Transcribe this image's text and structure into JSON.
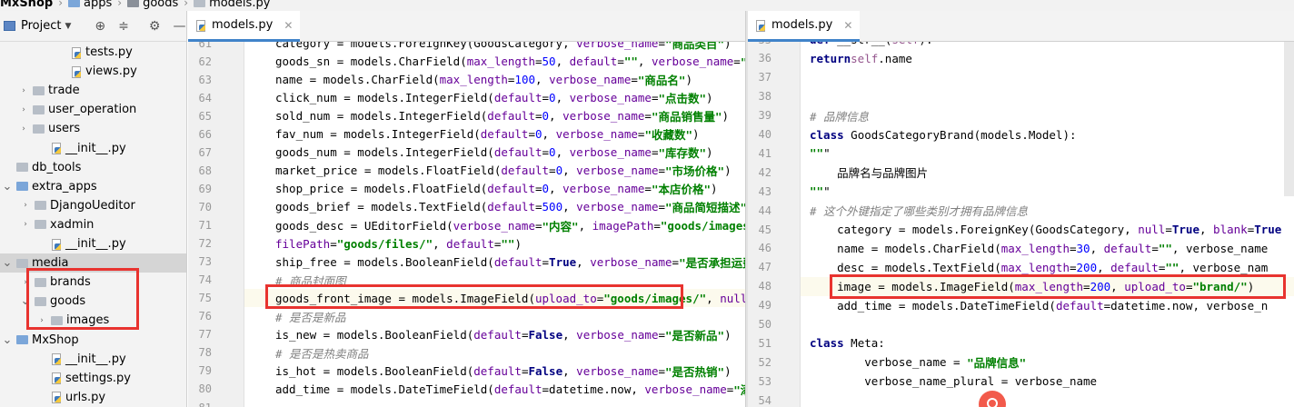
{
  "breadcrumb": {
    "items": [
      "MxShop",
      "apps",
      "goods",
      "models.py"
    ]
  },
  "project_panel": {
    "title": "Project",
    "tree": [
      {
        "label": "tests.py",
        "type": "py",
        "expanded": null
      },
      {
        "label": "views.py",
        "type": "py",
        "expanded": null
      },
      {
        "label": "trade",
        "type": "folder",
        "expanded": false
      },
      {
        "label": "user_operation",
        "type": "folder",
        "expanded": false
      },
      {
        "label": "users",
        "type": "folder",
        "expanded": false
      },
      {
        "label": "__init__.py",
        "type": "py",
        "expanded": null
      },
      {
        "label": "db_tools",
        "type": "folder",
        "expanded": null
      },
      {
        "label": "extra_apps",
        "type": "folder",
        "expanded": true
      },
      {
        "label": "DjangoUeditor",
        "type": "folder",
        "expanded": false
      },
      {
        "label": "xadmin",
        "type": "folder",
        "expanded": false
      },
      {
        "label": "__init__.py",
        "type": "py",
        "expanded": null
      },
      {
        "label": "media",
        "type": "folder",
        "expanded": true
      },
      {
        "label": "brands",
        "type": "folder",
        "expanded": false
      },
      {
        "label": "goods",
        "type": "folder",
        "expanded": true
      },
      {
        "label": "images",
        "type": "folder",
        "expanded": false
      },
      {
        "label": "MxShop",
        "type": "folder",
        "expanded": true
      },
      {
        "label": "__init__.py",
        "type": "py",
        "expanded": null
      },
      {
        "label": "settings.py",
        "type": "py",
        "expanded": null
      },
      {
        "label": "urls.py",
        "type": "py",
        "expanded": null
      }
    ]
  },
  "left_editor": {
    "tab": "models.py",
    "lines": [
      {
        "no": "61",
        "text": "category = models.ForeignKey(GoodsCategory, verbose_name=\"商品类目\")"
      },
      {
        "no": "62",
        "text": "goods_sn = models.CharField(max_length=50, default=\"\", verbose_name=\"商品唯一货号\")"
      },
      {
        "no": "63",
        "text": "name = models.CharField(max_length=100, verbose_name=\"商品名\")"
      },
      {
        "no": "64",
        "text": "click_num = models.IntegerField(default=0, verbose_name=\"点击数\")"
      },
      {
        "no": "65",
        "text": "sold_num = models.IntegerField(default=0, verbose_name=\"商品销售量\")"
      },
      {
        "no": "66",
        "text": "fav_num = models.IntegerField(default=0, verbose_name=\"收藏数\")"
      },
      {
        "no": "67",
        "text": "goods_num = models.IntegerField(default=0, verbose_name=\"库存数\")"
      },
      {
        "no": "68",
        "text": "market_price = models.FloatField(default=0, verbose_name=\"市场价格\")"
      },
      {
        "no": "69",
        "text": "shop_price = models.FloatField(default=0, verbose_name=\"本店价格\")"
      },
      {
        "no": "70",
        "text": "goods_brief = models.TextField(default=500, verbose_name=\"商品简短描述\")"
      },
      {
        "no": "71",
        "text": "goods_desc = UEditorField(verbose_name=\"内容\", imagePath=\"goods/images/\","
      },
      {
        "no": "72",
        "text": "                        filePath=\"goods/files/\", default=\"\")"
      },
      {
        "no": "73",
        "text": "ship_free = models.BooleanField(default=True, verbose_name=\"是否承担运费\")"
      },
      {
        "no": "74",
        "text": "# 商品封面图"
      },
      {
        "no": "75",
        "text": "goods_front_image = models.ImageField(upload_to=\"goods/images/\", null=True"
      },
      {
        "no": "76",
        "text": "# 是否是新品"
      },
      {
        "no": "77",
        "text": "is_new = models.BooleanField(default=False, verbose_name=\"是否新品\")"
      },
      {
        "no": "78",
        "text": "# 是否是热卖商品"
      },
      {
        "no": "79",
        "text": "is_hot = models.BooleanField(default=False, verbose_name=\"是否热销\")"
      },
      {
        "no": "80",
        "text": "add_time = models.DateTimeField(default=datetime.now, verbose_name=\"添加时间\")"
      },
      {
        "no": "81",
        "text": ""
      }
    ]
  },
  "right_editor": {
    "tab": "models.py",
    "lines": [
      {
        "no": "35",
        "text": "    def __str__(self):"
      },
      {
        "no": "36",
        "text": "        return self.name"
      },
      {
        "no": "37",
        "text": ""
      },
      {
        "no": "38",
        "text": ""
      },
      {
        "no": "39",
        "text": "# 品牌信息"
      },
      {
        "no": "40",
        "text": "class GoodsCategoryBrand(models.Model):"
      },
      {
        "no": "41",
        "text": "    \"\"\""
      },
      {
        "no": "42",
        "text": "    品牌名与品牌图片"
      },
      {
        "no": "43",
        "text": "    \"\"\""
      },
      {
        "no": "44",
        "text": "    # 这个外键指定了哪些类别才拥有品牌信息"
      },
      {
        "no": "45",
        "text": "    category = models.ForeignKey(GoodsCategory, null=True, blank=True"
      },
      {
        "no": "46",
        "text": "    name = models.CharField(max_length=30, default=\"\", verbose_name"
      },
      {
        "no": "47",
        "text": "    desc = models.TextField(max_length=200, default=\"\", verbose_nam"
      },
      {
        "no": "48",
        "text": "    image = models.ImageField(max_length=200, upload_to=\"brand/\")"
      },
      {
        "no": "49",
        "text": "    add_time = models.DateTimeField(default=datetime.now, verbose_n"
      },
      {
        "no": "50",
        "text": ""
      },
      {
        "no": "51",
        "text": "    class Meta:"
      },
      {
        "no": "52",
        "text": "        verbose_name = \"品牌信息\""
      },
      {
        "no": "53",
        "text": "        verbose_name_plural = verbose_name"
      },
      {
        "no": "54",
        "text": ""
      }
    ]
  },
  "colors": {
    "highlight_box": "#e8332f",
    "tab_underline": "#4083c9",
    "current_line": "#fcfaed"
  }
}
